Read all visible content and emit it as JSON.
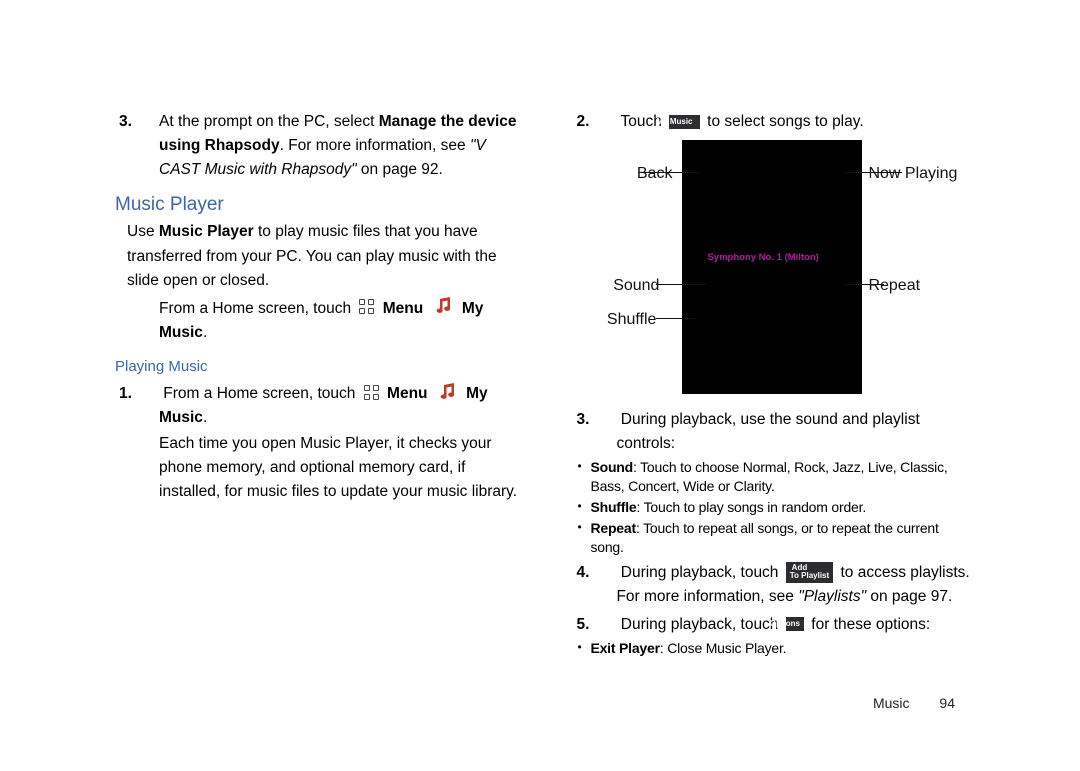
{
  "left": {
    "step3": {
      "num": "3.",
      "pre": "At the prompt on the PC, select ",
      "b1": "Manage the device using Rhapsody",
      "mid": ". For more information, see ",
      "ital": "\"V CAST Music with Rhapsody\"",
      "post": " on page 92."
    },
    "section": "Music Player",
    "intro": {
      "pre": "Use ",
      "b1": "Music Player",
      "post": " to play music files that you have transferred from your PC. You can play music with the slide open or closed."
    },
    "home": {
      "pre": "From a Home screen, touch ",
      "menu": "Menu",
      "mymusic": "My Music",
      "dot": "."
    },
    "sub": "Playing Music",
    "step1": {
      "num": "1.",
      "pre": " From a Home screen, touch ",
      "menu": "Menu",
      "mymusic": "My Music",
      "dot": ".",
      "cont": "Each time you open Music Player, it checks your phone memory, and optional memory card, if installed, for music files to update your music library."
    }
  },
  "right": {
    "step2": {
      "num": "2.",
      "pre": " Touch ",
      "chip": "My Music",
      "post": " to select songs to play."
    },
    "labels": {
      "back": "Back",
      "now": "Now Playing",
      "sound": "Sound",
      "repeat": "Repeat",
      "shuffle": "Shuffle"
    },
    "song": "Symphony No. 1 (Milton)",
    "step3": {
      "num": "3.",
      "text": " During playback, use the sound and playlist controls:",
      "bullets": {
        "sound_label": "Sound",
        "sound": ": Touch to choose Normal, Rock, Jazz, Live, Classic, Bass, Concert, Wide or Clarity.",
        "shuffle_label": "Shuffle",
        "shuffle": ": Touch to play songs in random order.",
        "repeat_label": "Repeat",
        "repeat": ": Touch to repeat all songs, or to repeat the current song."
      }
    },
    "step4": {
      "num": "4.",
      "pre": " During playback, touch ",
      "chip1": "Add",
      "chip2": "To Playlist",
      "post": " to access playlists. For more information, see ",
      "ital": "\"Playlists\"",
      "ref": " on page 97."
    },
    "step5": {
      "num": "5.",
      "pre": " During playback, touch ",
      "chip": "Options",
      "post": " for these options:",
      "b1_label": "Exit Player",
      "b1": ": Close Music Player."
    }
  },
  "footer": {
    "section": "Music",
    "page": "94"
  }
}
